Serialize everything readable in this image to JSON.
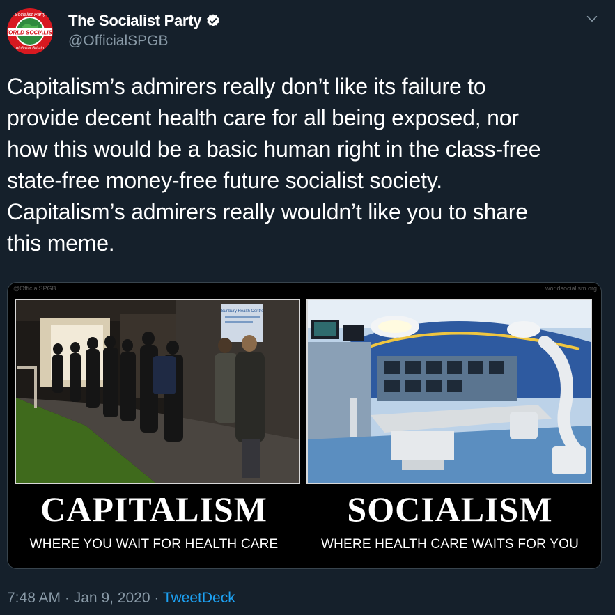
{
  "tweet": {
    "display_name": "The Socialist Party",
    "handle": "@OfficialSPGB",
    "text": "Capitalism’s admirers really don’t like its failure to\nprovide decent health care for all being exposed, nor\nhow this would be a basic human right in the class-free\nstate-free money-free future socialist society.\nCapitalism’s admirers really wouldn’t like you to share\nthis meme.",
    "time": "7:48 AM",
    "separator": "·",
    "date": "Jan 9, 2020",
    "app": "TweetDeck"
  },
  "avatar": {
    "top_text": "Socialist Party",
    "band_text": "WORLD SOCIALISM",
    "bottom_text": "of Great Britain"
  },
  "meme": {
    "watermark_left": "@OfficialSPGB",
    "watermark_right": "worldsocialism.org",
    "sign_text": "Sunbury Health Centre",
    "left_title": "CAPITALISM",
    "left_subtitle": "WHERE YOU WAIT FOR HEALTH CARE",
    "right_title": "SOCIALISM",
    "right_subtitle": "WHERE HEALTH CARE WAITS FOR YOU"
  },
  "icons": {
    "verified": "verified-badge-icon",
    "chevron": "chevron-down-icon"
  },
  "colors": {
    "background": "#15202b",
    "secondary_text": "#8899a6",
    "link": "#1da1f2",
    "border": "#38444d",
    "avatar_red": "#d71920",
    "avatar_green": "#2e8b3e"
  }
}
